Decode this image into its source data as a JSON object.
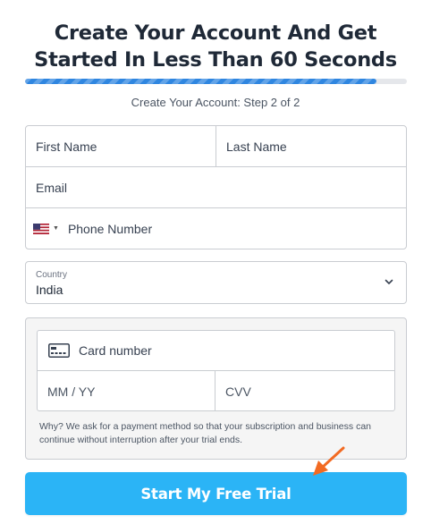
{
  "header": {
    "title_line1": "Create Your Account And Get",
    "title_line2": "Started In Less Than 60 Seconds"
  },
  "progress": {
    "fraction": 0.92,
    "color": "#2f86e0"
  },
  "step": {
    "text": "Create Your Account: Step 2 of 2"
  },
  "form": {
    "first_name_placeholder": "First Name",
    "last_name_placeholder": "Last Name",
    "email_placeholder": "Email",
    "phone_placeholder": "Phone Number",
    "phone_flag": "us-flag-icon",
    "country": {
      "caption": "Country",
      "value": "India"
    }
  },
  "payment": {
    "card_number_placeholder": "Card number",
    "card_icon": "credit-card-icon",
    "expiry_placeholder": "MM / YY",
    "cvv_placeholder": "CVV",
    "note": "Why? We ask for a payment method so that your subscription and business can continue without interruption after your trial ends."
  },
  "cta": {
    "label": "Start My Free Trial",
    "color": "#2bb4f6"
  },
  "annotation": {
    "arrow_icon": "arrow-pointer-icon",
    "color": "#f26a22"
  }
}
